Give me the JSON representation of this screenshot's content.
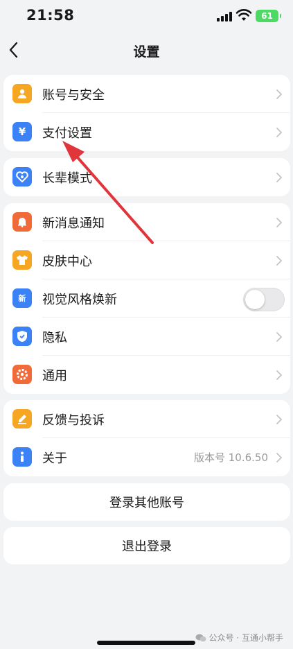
{
  "status_bar": {
    "time": "21:58",
    "battery": "61"
  },
  "header": {
    "title": "设置"
  },
  "groups": [
    {
      "items": [
        {
          "label": "账号与安全",
          "icon": "person-icon",
          "color": "#f5a623"
        },
        {
          "label": "支付设置",
          "icon": "yen-icon",
          "color": "#3b82f6"
        }
      ]
    },
    {
      "items": [
        {
          "label": "长辈模式",
          "icon": "heart-icon",
          "color": "#3b82f6"
        }
      ]
    },
    {
      "items": [
        {
          "label": "新消息通知",
          "icon": "bell-icon",
          "color": "#f06a3a"
        },
        {
          "label": "皮肤中心",
          "icon": "shirt-icon",
          "color": "#f5a623"
        },
        {
          "label": "视觉风格焕新",
          "icon": "refresh-style-icon",
          "color": "#3b82f6",
          "toggle": false,
          "icon_text": "新"
        },
        {
          "label": "隐私",
          "icon": "shield-icon",
          "color": "#3b82f6"
        },
        {
          "label": "通用",
          "icon": "gear-icon",
          "color": "#f06a3a"
        }
      ]
    },
    {
      "items": [
        {
          "label": "反馈与投诉",
          "icon": "edit-icon",
          "color": "#f5a623"
        },
        {
          "label": "关于",
          "icon": "info-icon",
          "color": "#3b82f6",
          "value": "版本号 10.6.50"
        }
      ]
    }
  ],
  "actions": {
    "switch_account": "登录其他账号",
    "logout": "退出登录"
  },
  "watermark": "公众号 · 互通小帮手",
  "colors": {
    "annotation_arrow": "#e0353b",
    "background": "#f2f3f5"
  }
}
